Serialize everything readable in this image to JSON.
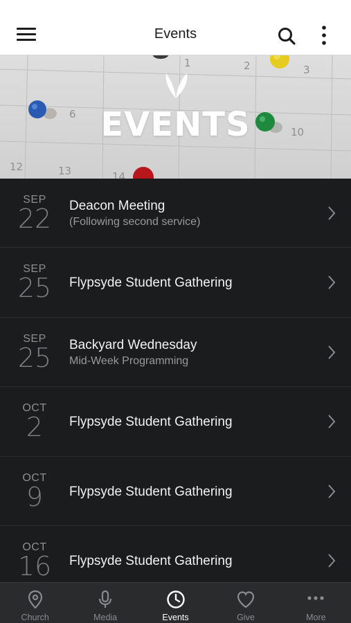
{
  "header": {
    "title": "Events",
    "menu_icon": "hamburger-menu-icon",
    "search_icon": "search-icon",
    "more_icon": "vertical-dots-icon"
  },
  "banner": {
    "heading": "EVENTS",
    "logo_icon": "leaf-logo-icon",
    "calendar_numbers": [
      "1",
      "2",
      "3",
      "6",
      "10",
      "12",
      "13",
      "14"
    ]
  },
  "events": [
    {
      "month": "SEP",
      "day": "22",
      "title": "Deacon Meeting",
      "subtitle": "(Following second service)"
    },
    {
      "month": "SEP",
      "day": "25",
      "title": "Flypsyde Student Gathering",
      "subtitle": ""
    },
    {
      "month": "SEP",
      "day": "25",
      "title": "Backyard Wednesday",
      "subtitle": "Mid-Week Programming"
    },
    {
      "month": "OCT",
      "day": "2",
      "title": "Flypsyde Student Gathering",
      "subtitle": ""
    },
    {
      "month": "OCT",
      "day": "9",
      "title": "Flypsyde Student Gathering",
      "subtitle": ""
    },
    {
      "month": "OCT",
      "day": "16",
      "title": "Flypsyde Student Gathering",
      "subtitle": ""
    }
  ],
  "tabs": [
    {
      "label": "Church",
      "icon": "location-pin-icon",
      "active": false
    },
    {
      "label": "Media",
      "icon": "microphone-icon",
      "active": false
    },
    {
      "label": "Events",
      "icon": "clock-icon",
      "active": true
    },
    {
      "label": "Give",
      "icon": "heart-icon",
      "active": false
    },
    {
      "label": "More",
      "icon": "horizontal-dots-icon",
      "active": false
    }
  ],
  "colors": {
    "background": "#1b1c1e",
    "header_bg": "#ffffff",
    "tabbar_bg": "#2a2b2d",
    "active_tab": "#ffffff",
    "inactive_tab": "#8a8b8e"
  }
}
